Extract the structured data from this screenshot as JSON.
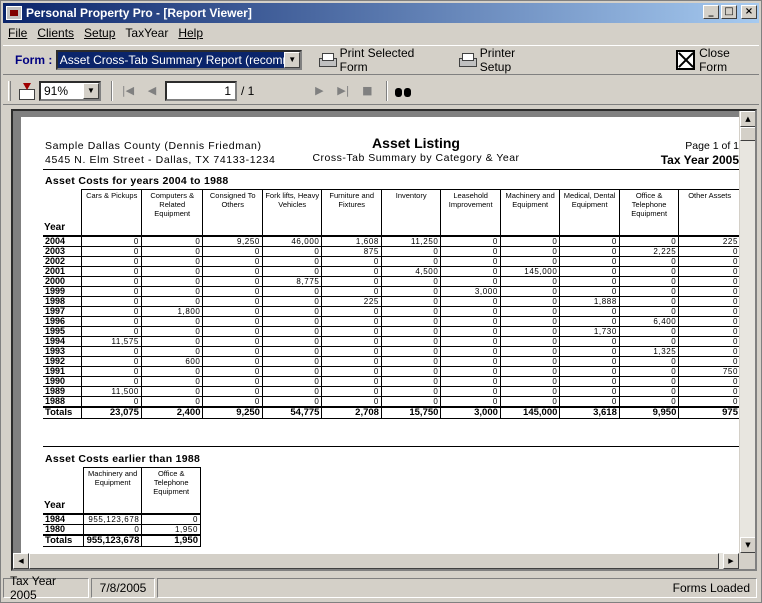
{
  "window": {
    "title": "Personal Property Pro - [Report Viewer]",
    "btn_min": "_",
    "btn_max": "□",
    "btn_close": "×"
  },
  "menu": [
    "File",
    "Clients",
    "Setup",
    "TaxYear",
    "Help"
  ],
  "formbar": {
    "label": "Form :",
    "selected": "Asset Cross-Tab Summary Report (recommended",
    "print_selected": "Print Selected Form",
    "printer_setup": "Printer Setup",
    "close_form": "Close Form"
  },
  "viewer": {
    "zoom": "91%",
    "page": "1",
    "page_total": "/ 1"
  },
  "icons": [
    "export-icon",
    "first-page-icon",
    "prev-page-icon",
    "next-page-icon",
    "last-page-icon",
    "stop-icon",
    "find-icon",
    "printer-icon",
    "close-form-icon"
  ],
  "report": {
    "company_line1": "Sample Dallas County (Dennis Friedman)",
    "company_line2": "4545 N. Elm Street - Dallas, TX  74133-1234",
    "title": "Asset Listing",
    "subtitle": "Cross-Tab Summary by Category & Year",
    "page_info": "Page 1 of 1",
    "tax_year": "Tax Year 2005",
    "section1": {
      "title": "Asset Costs for years 2004 to 1988",
      "year_header": "Year",
      "columns": [
        "Cars & Pickups",
        "Computers & Related Equipment",
        "Consigned To Others",
        "Fork lifts, Heavy Vehicles",
        "Furniture and Fixtures",
        "Inventory",
        "Leasehold Improvement",
        "Machinery and Equipment",
        "Medical, Dental Equipment",
        "Office & Telephone Equipment",
        "Other Assets"
      ],
      "rows": [
        {
          "year": "2004",
          "values": [
            "0",
            "0",
            "9,250",
            "46,000",
            "1,608",
            "11,250",
            "0",
            "0",
            "0",
            "0",
            "225"
          ]
        },
        {
          "year": "2003",
          "values": [
            "0",
            "0",
            "0",
            "0",
            "875",
            "0",
            "0",
            "0",
            "0",
            "2,225",
            "0"
          ]
        },
        {
          "year": "2002",
          "values": [
            "0",
            "0",
            "0",
            "0",
            "0",
            "0",
            "0",
            "0",
            "0",
            "0",
            "0"
          ]
        },
        {
          "year": "2001",
          "values": [
            "0",
            "0",
            "0",
            "0",
            "0",
            "4,500",
            "0",
            "145,000",
            "0",
            "0",
            "0"
          ]
        },
        {
          "year": "2000",
          "values": [
            "0",
            "0",
            "0",
            "8,775",
            "0",
            "0",
            "0",
            "0",
            "0",
            "0",
            "0"
          ]
        },
        {
          "year": "1999",
          "values": [
            "0",
            "0",
            "0",
            "0",
            "0",
            "0",
            "3,000",
            "0",
            "0",
            "0",
            "0"
          ]
        },
        {
          "year": "1998",
          "values": [
            "0",
            "0",
            "0",
            "0",
            "225",
            "0",
            "0",
            "0",
            "1,888",
            "0",
            "0"
          ]
        },
        {
          "year": "1997",
          "values": [
            "0",
            "1,800",
            "0",
            "0",
            "0",
            "0",
            "0",
            "0",
            "0",
            "0",
            "0"
          ]
        },
        {
          "year": "1996",
          "values": [
            "0",
            "0",
            "0",
            "0",
            "0",
            "0",
            "0",
            "0",
            "0",
            "6,400",
            "0"
          ]
        },
        {
          "year": "1995",
          "values": [
            "0",
            "0",
            "0",
            "0",
            "0",
            "0",
            "0",
            "0",
            "1,730",
            "0",
            "0"
          ]
        },
        {
          "year": "1994",
          "values": [
            "11,575",
            "0",
            "0",
            "0",
            "0",
            "0",
            "0",
            "0",
            "0",
            "0",
            "0"
          ]
        },
        {
          "year": "1993",
          "values": [
            "0",
            "0",
            "0",
            "0",
            "0",
            "0",
            "0",
            "0",
            "0",
            "1,325",
            "0"
          ]
        },
        {
          "year": "1992",
          "values": [
            "0",
            "600",
            "0",
            "0",
            "0",
            "0",
            "0",
            "0",
            "0",
            "0",
            "0"
          ]
        },
        {
          "year": "1991",
          "values": [
            "0",
            "0",
            "0",
            "0",
            "0",
            "0",
            "0",
            "0",
            "0",
            "0",
            "750"
          ]
        },
        {
          "year": "1990",
          "values": [
            "0",
            "0",
            "0",
            "0",
            "0",
            "0",
            "0",
            "0",
            "0",
            "0",
            "0"
          ]
        },
        {
          "year": "1989",
          "values": [
            "11,500",
            "0",
            "0",
            "0",
            "0",
            "0",
            "0",
            "0",
            "0",
            "0",
            "0"
          ]
        },
        {
          "year": "1988",
          "values": [
            "0",
            "0",
            "0",
            "0",
            "0",
            "0",
            "0",
            "0",
            "0",
            "0",
            "0"
          ]
        }
      ],
      "totals_label": "Totals",
      "totals": [
        "23,075",
        "2,400",
        "9,250",
        "54,775",
        "2,708",
        "15,750",
        "3,000",
        "145,000",
        "3,618",
        "9,950",
        "975"
      ]
    },
    "section2": {
      "title": "Asset Costs earlier than 1988",
      "year_header": "Year",
      "columns": [
        "Machinery and Equipment",
        "Office & Telephone Equipment"
      ],
      "rows": [
        {
          "year": "1984",
          "values": [
            "955,123,678",
            "0"
          ]
        },
        {
          "year": "1980",
          "values": [
            "0",
            "1,950"
          ]
        }
      ],
      "totals_label": "Totals",
      "totals": [
        "955,123,678",
        "1,950"
      ]
    }
  },
  "status": {
    "tax_year": "Tax Year 2005",
    "date": "7/8/2005",
    "message": "Forms Loaded"
  }
}
